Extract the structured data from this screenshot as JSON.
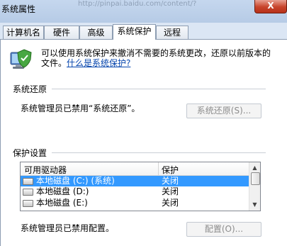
{
  "window": {
    "title": "系统属性",
    "ghost_url": "http://pinpai.baidu.com/content/?",
    "close_label": "X"
  },
  "tabs": [
    {
      "label": "计算机名"
    },
    {
      "label": "硬件"
    },
    {
      "label": "高级"
    },
    {
      "label": "系统保护",
      "active": true
    },
    {
      "label": "远程"
    }
  ],
  "intro": {
    "text": "可以使用系统保护来撤消不需要的系统更改，还原以前版本的文件。",
    "link": "什么是系统保护?"
  },
  "restore": {
    "group": "系统还原",
    "message": "系统管理员已禁用“系统还原”。",
    "button": "系统还原(S)..."
  },
  "protection": {
    "group": "保护设置",
    "columns": [
      "可用驱动器",
      "保护"
    ],
    "drives": [
      {
        "name": "本地磁盘 (C:) (系统)",
        "state": "关闭",
        "selected": true
      },
      {
        "name": "本地磁盘 (D:)",
        "state": "关闭"
      },
      {
        "name": "本地磁盘 (E:)",
        "state": "关闭"
      }
    ],
    "message": "系统管理员已禁用配置。",
    "button": "配置(O)..."
  },
  "colors": {
    "selection": "#3399ff",
    "link": "#0645ad",
    "disabled_text": "#8c8c8c"
  },
  "icons": [
    "shield-icon",
    "drive-icon",
    "scroll-up-icon",
    "scroll-down-icon"
  ]
}
